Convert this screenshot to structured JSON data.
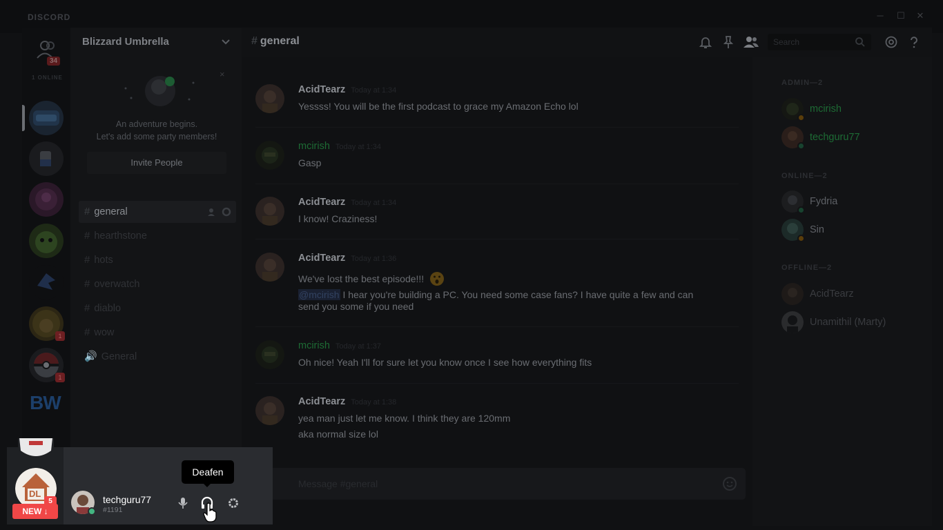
{
  "window": {
    "brand": "DISCORD",
    "minimize": "─",
    "maximize": "☐",
    "close": "✕"
  },
  "friends": {
    "badge": "34",
    "online_label": "1 ONLINE"
  },
  "server_badges": [
    "1",
    "1"
  ],
  "bw_label": "BW",
  "guild": {
    "name": "Blizzard Umbrella"
  },
  "invite_card": {
    "line1": "An adventure begins.",
    "line2": "Let's add some party members!",
    "button": "Invite People",
    "close": "×"
  },
  "channels": [
    {
      "hash": "#",
      "name": "general",
      "active": true
    },
    {
      "hash": "#",
      "name": "hearthstone"
    },
    {
      "hash": "#",
      "name": "hots"
    },
    {
      "hash": "#",
      "name": "overwatch"
    },
    {
      "hash": "#",
      "name": "diablo"
    },
    {
      "hash": "#",
      "name": "wow"
    },
    {
      "hash": "🔊",
      "name": "General"
    }
  ],
  "header": {
    "hash": "#",
    "channel": "general",
    "search_placeholder": "Search"
  },
  "messages": [
    {
      "author": "AcidTearz",
      "timestamp": "Today at 1:34",
      "lines": [
        "Yessss! You will be the first podcast to grace my Amazon Echo lol"
      ]
    },
    {
      "author": "mcirish",
      "timestamp": "Today at 1:34",
      "lines": [
        "Gasp"
      ]
    },
    {
      "author": "AcidTearz",
      "timestamp": "Today at 1:34",
      "lines": [
        "I know! Craziness!"
      ]
    },
    {
      "author": "AcidTearz",
      "timestamp": "Today at 1:36",
      "lines": [
        "We've lost the best episode!!!",
        "I hear you're building a PC. You need some case fans? I have quite a few and can",
        "send you some if you need"
      ],
      "mention": "@mcirish"
    },
    {
      "author": "mcirish",
      "timestamp": "Today at 1:37",
      "lines": [
        "Oh nice!  Yeah I'll for sure let you know once I see how everything fits"
      ]
    },
    {
      "author": "AcidTearz",
      "timestamp": "Today at 1:38",
      "lines": [
        "yea man just let me know. I think they are 120mm",
        "aka normal size lol"
      ]
    }
  ],
  "composer": {
    "placeholder": "Message #general"
  },
  "members": {
    "groups": [
      {
        "label": "ADMIN—2",
        "members": [
          {
            "name": "mcirish"
          },
          {
            "name": "techguru77"
          }
        ]
      },
      {
        "label": "ONLINE—2",
        "members": [
          {
            "name": "Fydria"
          },
          {
            "name": "Sin"
          }
        ]
      },
      {
        "label": "OFFLINE—2",
        "members": [
          {
            "name": "AcidTearz"
          },
          {
            "name": "Unamithil (Marty)"
          }
        ]
      }
    ]
  },
  "user": {
    "name": "techguru77",
    "tag": "#1191"
  },
  "tooltip": "Deafen",
  "dl_server": {
    "label": "DL",
    "badge": "5"
  },
  "new_button": "NEW ↓",
  "colors": {
    "online": "#43b581",
    "idle": "#faa61a",
    "red": "#f04747",
    "green_name": "#1d6b34"
  }
}
